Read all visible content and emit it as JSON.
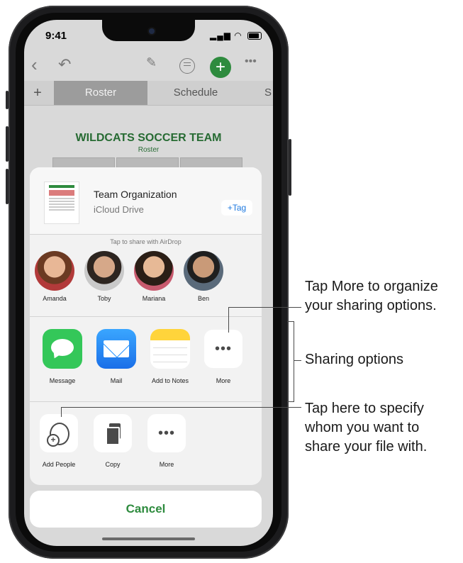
{
  "status": {
    "time": "9:41"
  },
  "app": {
    "tabs": [
      "Roster",
      "Schedule"
    ],
    "add_tab": "+",
    "team_title": "WILDCATS SOCCER TEAM",
    "team_subtitle": "Roster"
  },
  "share_sheet": {
    "document": {
      "title": "Team Organization",
      "location": "iCloud Drive",
      "tag_label": "+Tag"
    },
    "airdrop_label": "Tap to share with AirDrop",
    "people": [
      {
        "name": "Amanda"
      },
      {
        "name": "Toby"
      },
      {
        "name": "Mariana"
      },
      {
        "name": "Ben"
      }
    ],
    "apps": [
      {
        "label": "Message",
        "icon": "message-icon"
      },
      {
        "label": "Mail",
        "icon": "mail-icon"
      },
      {
        "label": "Add to Notes",
        "icon": "notes-icon"
      },
      {
        "label": "More",
        "icon": "more-icon"
      }
    ],
    "actions": [
      {
        "label": "Add People",
        "icon": "add-people-icon"
      },
      {
        "label": "Copy",
        "icon": "copy-icon"
      },
      {
        "label": "More",
        "icon": "more-icon"
      }
    ],
    "cancel_label": "Cancel"
  },
  "callouts": {
    "more_line1": "Tap More to organize",
    "more_line2": "your sharing options.",
    "sharing_options": "Sharing options",
    "add_people_line1": "Tap here to specify",
    "add_people_line2": "whom you want to",
    "add_people_line3": "share your file with."
  },
  "colors": {
    "accent_green": "#2e8b3e",
    "tag_blue": "#1f7ae0",
    "message_green": "#34c759",
    "mail_blue": "#1a8cff",
    "notes_yellow": "#ffd43b"
  }
}
